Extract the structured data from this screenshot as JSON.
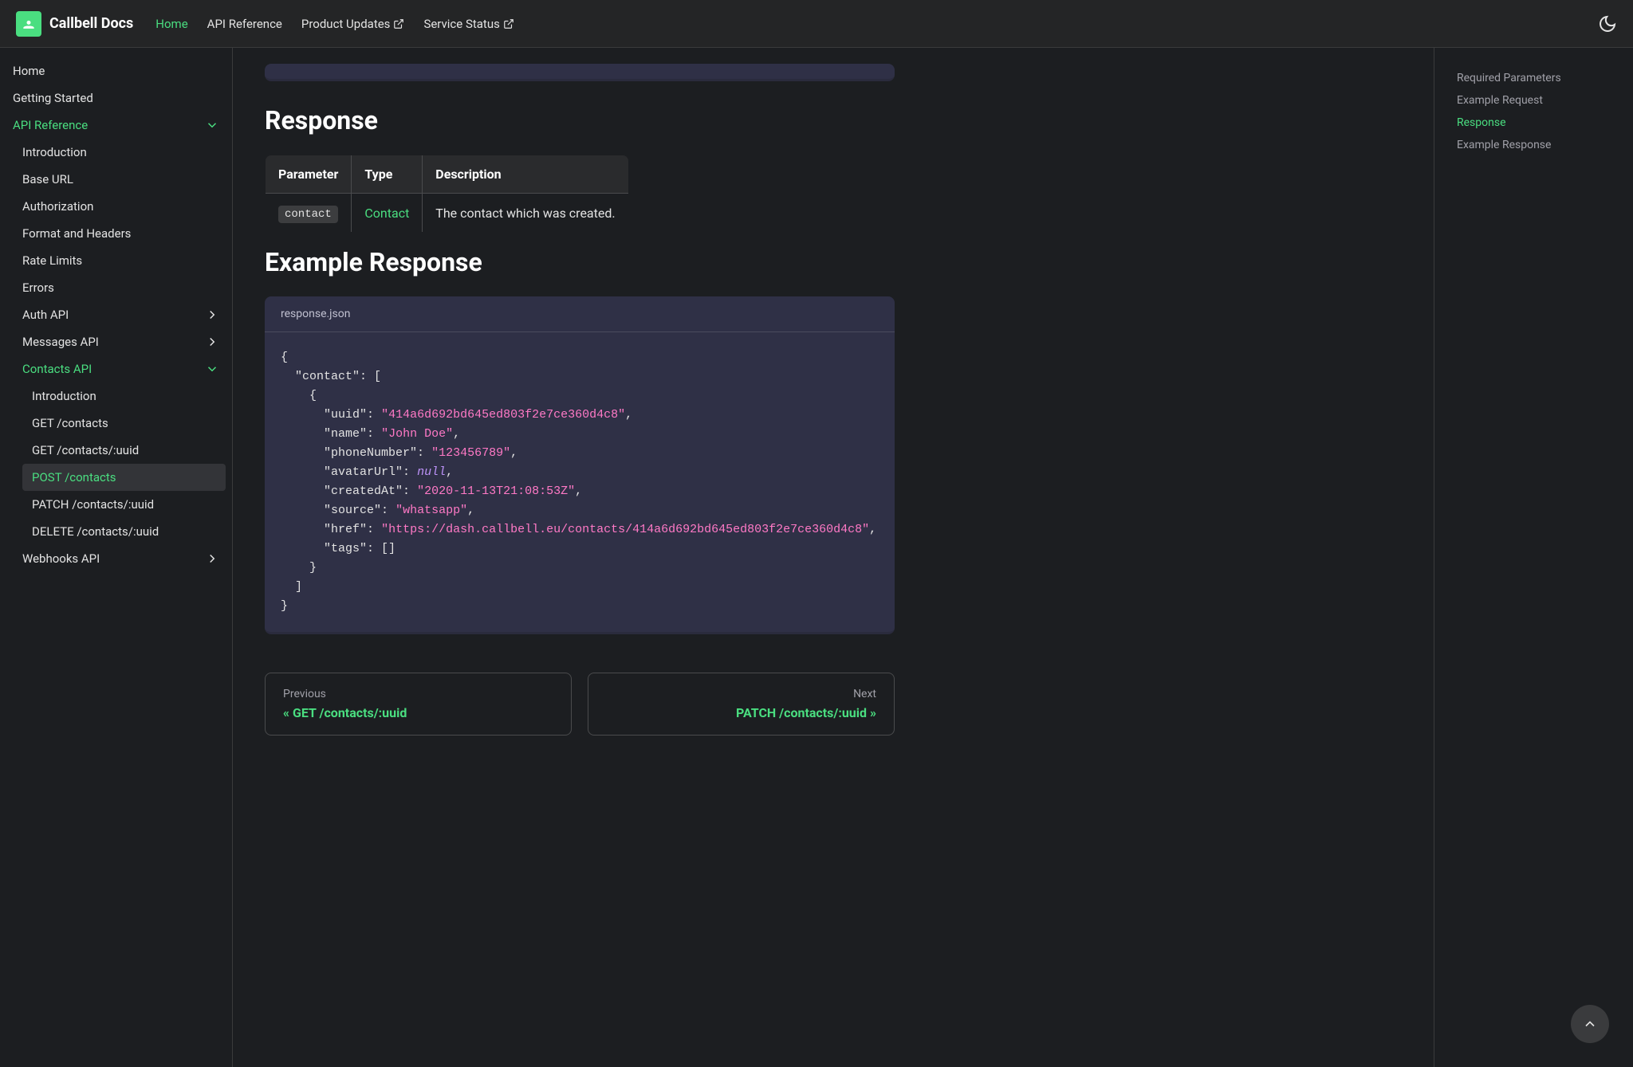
{
  "brand": "Callbell Docs",
  "nav": {
    "home": "Home",
    "api_reference": "API Reference",
    "product_updates": "Product Updates",
    "service_status": "Service Status"
  },
  "sidebar": {
    "home": "Home",
    "getting_started": "Getting Started",
    "api_reference": "API Reference",
    "introduction": "Introduction",
    "base_url": "Base URL",
    "authorization": "Authorization",
    "format_headers": "Format and Headers",
    "rate_limits": "Rate Limits",
    "errors": "Errors",
    "auth_api": "Auth API",
    "messages_api": "Messages API",
    "contacts_api": "Contacts API",
    "contacts_intro": "Introduction",
    "get_contacts": "GET /contacts",
    "get_contact_uuid": "GET /contacts/:uuid",
    "post_contacts": "POST /contacts",
    "patch_contacts": "PATCH /contacts/:uuid",
    "delete_contacts": "DELETE /contacts/:uuid",
    "webhooks_api": "Webhooks API"
  },
  "toc": {
    "required_parameters": "Required Parameters",
    "example_request": "Example Request",
    "response": "Response",
    "example_response": "Example Response"
  },
  "headings": {
    "response": "Response",
    "example_response": "Example Response"
  },
  "table": {
    "h1": "Parameter",
    "h2": "Type",
    "h3": "Description",
    "param": "contact",
    "type": "Contact",
    "desc": "The contact which was created."
  },
  "code": {
    "title": "response.json",
    "uuid": "\"414a6d692bd645ed803f2e7ce360d4c8\"",
    "name": "\"John Doe\"",
    "phone": "\"123456789\"",
    "created": "\"2020-11-13T21:08:53Z\"",
    "source": "\"whatsapp\"",
    "href": "\"https://dash.callbell.eu/contacts/414a6d692bd645ed803f2e7ce360d4c8\""
  },
  "pagination": {
    "prev_label": "Previous",
    "prev_title": "« GET /contacts/:uuid",
    "next_label": "Next",
    "next_title": "PATCH /contacts/:uuid »"
  }
}
